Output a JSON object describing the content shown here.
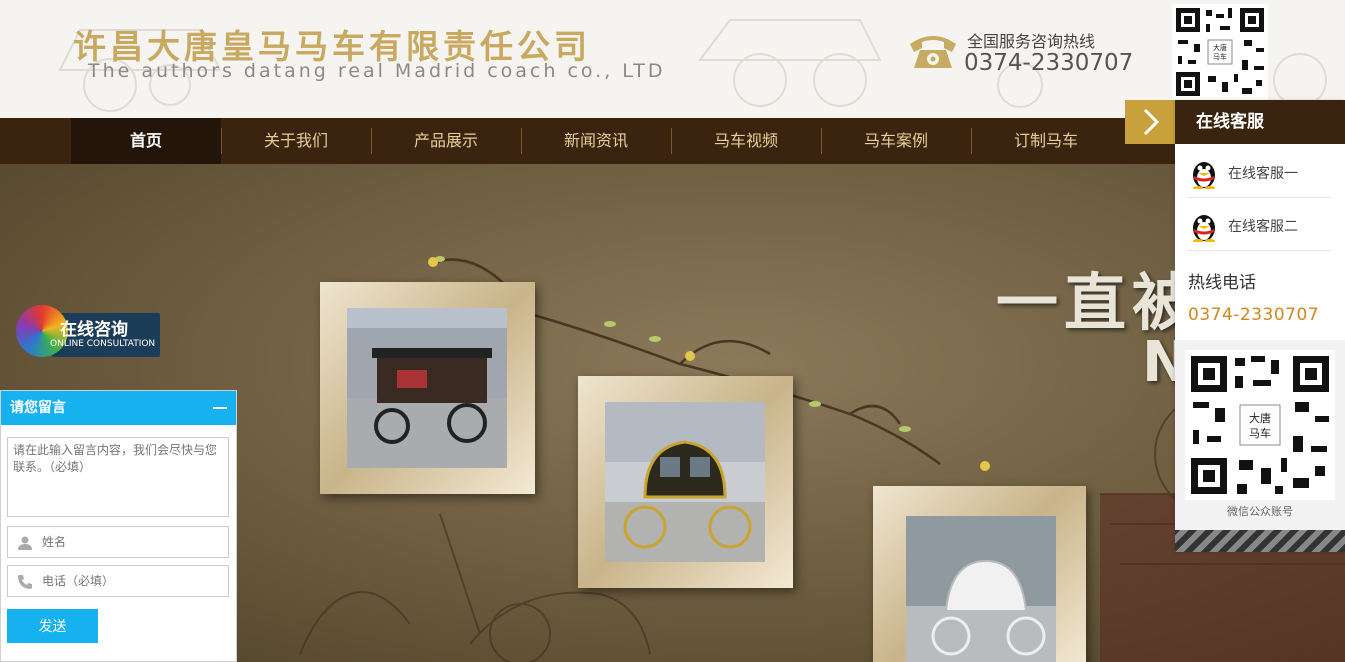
{
  "header": {
    "company_name_cn": "许昌大唐皇马马车有限责任公司",
    "company_name_en": "The authors datang real Madrid coach co., LTD",
    "hotline_label": "全国服务咨询热线",
    "hotline_number": "0374-2330707"
  },
  "nav": {
    "items": [
      {
        "label": "首页",
        "active": true
      },
      {
        "label": "关于我们"
      },
      {
        "label": "产品展示"
      },
      {
        "label": "新闻资讯"
      },
      {
        "label": "马车视频"
      },
      {
        "label": "马车案例"
      },
      {
        "label": "订制马车"
      }
    ]
  },
  "banner": {
    "headline_visible": "一直被",
    "sub_visible": "N"
  },
  "consult_badge": {
    "label_cn": "在线咨询",
    "label_en": "ONLINE CONSULTATION"
  },
  "message_panel": {
    "title": "请您留言",
    "content_placeholder": "请在此输入留言内容，我们会尽快与您联系。（必填）",
    "name_placeholder": "姓名",
    "phone_placeholder": "电话（必填）",
    "send_label": "发送"
  },
  "service_panel": {
    "title": "在线客服",
    "agents": [
      "在线客服一",
      "在线客服二"
    ],
    "hotline_title": "热线电话",
    "hotline_number": "0374-2330707",
    "qr_label": "微信公众账号"
  },
  "colors": {
    "nav_bg": "#3a2410",
    "brand_gold": "#c9a860",
    "accent_blue": "#16b1ef",
    "hotline_orange": "#d4861e"
  }
}
